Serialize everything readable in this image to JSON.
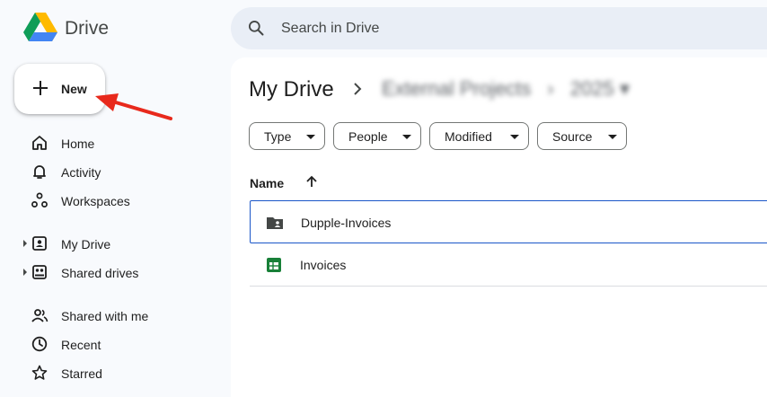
{
  "header": {
    "app_name": "Drive",
    "search_placeholder": "Search in Drive"
  },
  "new_button": {
    "label": "New"
  },
  "sidebar": {
    "items": [
      {
        "label": "Home",
        "icon": "home-icon"
      },
      {
        "label": "Activity",
        "icon": "bell-icon"
      },
      {
        "label": "Workspaces",
        "icon": "workspaces-icon"
      },
      {
        "label": "My Drive",
        "icon": "my-drive-icon",
        "expandable": true
      },
      {
        "label": "Shared drives",
        "icon": "shared-drives-icon",
        "expandable": true
      },
      {
        "label": "Shared with me",
        "icon": "people-icon"
      },
      {
        "label": "Recent",
        "icon": "clock-icon"
      },
      {
        "label": "Starred",
        "icon": "star-icon"
      }
    ]
  },
  "main": {
    "breadcrumb": {
      "title": "My Drive",
      "blurred_1": "External Projects",
      "blurred_2": "2025"
    },
    "filters": [
      {
        "label": "Type"
      },
      {
        "label": "People"
      },
      {
        "label": "Modified"
      },
      {
        "label": "Source"
      }
    ],
    "column_name": "Name",
    "files": [
      {
        "name": "Dupple-Invoices",
        "icon": "shared-folder-icon",
        "selected": true
      },
      {
        "name": "Invoices",
        "icon": "sheets-icon",
        "selected": false
      }
    ]
  },
  "colors": {
    "accent": "#1a56c8",
    "arrow": "#e8291c",
    "sheets_green": "#188038"
  }
}
